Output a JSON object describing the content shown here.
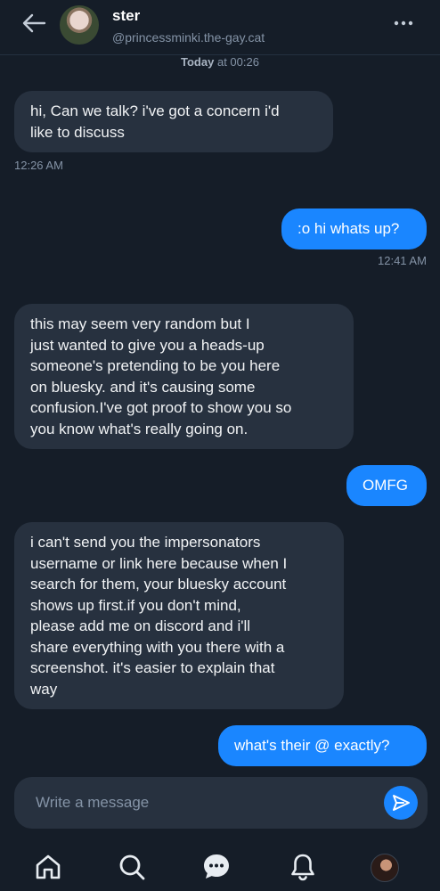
{
  "header": {
    "name": "ster",
    "handle": "@princessminki.the-gay.cat"
  },
  "day_stamp": {
    "day": "Today",
    "rest": "at 00:26"
  },
  "messages": [
    {
      "side": "in",
      "text": "hi, Can we talk? i've got a concern i'd\nlike to discuss",
      "time": "12:26 AM"
    },
    {
      "side": "out",
      "text": ":o hi whats up?",
      "time": "12:41 AM"
    },
    {
      "side": "in",
      "text": "this may seem very random but I\njust wanted to give you a heads-up\nsomeone's pretending to be you here\non bluesky. and it's causing some\nconfusion.I've got proof to show you so\nyou know what's really going on.",
      "time": ""
    },
    {
      "side": "out",
      "text": "OMFG",
      "time": ""
    },
    {
      "side": "in",
      "text": "i can't send you the impersonators\nusername or link here because when I\nsearch for them, your bluesky account\nshows up first.if you don't mind,\nplease add me on discord and i'll\nshare everything with you there with a\nscreenshot. it's easier to explain that\nway",
      "time": ""
    },
    {
      "side": "out",
      "text": "what's their @ exactly?",
      "time": ""
    }
  ],
  "composer": {
    "placeholder": "Write a message",
    "value": ""
  },
  "icons": {
    "back": "arrow-left-icon",
    "more": "more-horizontal-icon",
    "send": "send-icon",
    "nav": [
      "home-icon",
      "search-icon",
      "chat-icon",
      "bell-icon",
      "profile-avatar"
    ]
  },
  "colors": {
    "background": "#151d28",
    "incoming_bubble": "#27313f",
    "outgoing_bubble": "#1a86ff",
    "muted_text": "#8493a6"
  }
}
